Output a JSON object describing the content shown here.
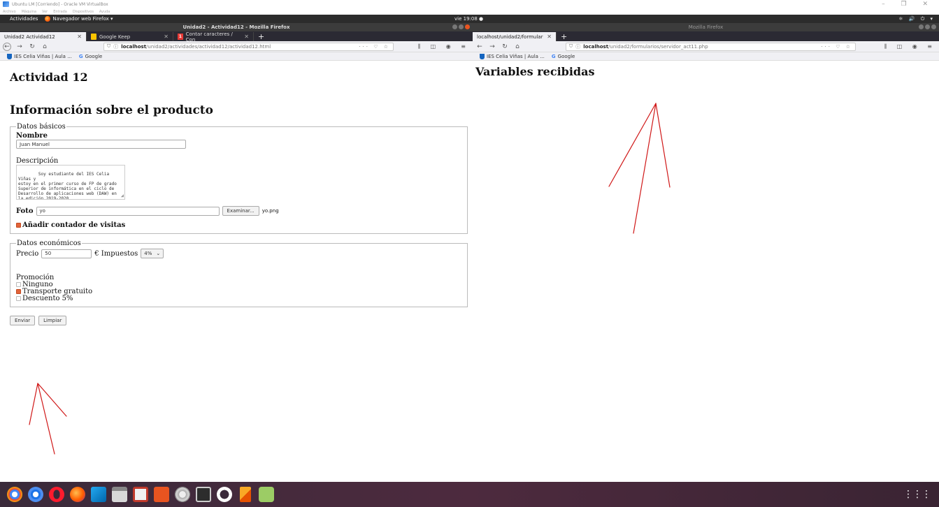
{
  "vbox": {
    "title": "Ubuntu LM [Corriendo] - Oracle VM VirtualBox",
    "menu": [
      "Archivo",
      "Máquina",
      "Ver",
      "Entrada",
      "Dispositivos",
      "Ayuda"
    ],
    "window_controls": "–  ❐  ✕"
  },
  "topbar": {
    "activities": "Actividades",
    "app": "Navegador web Firefox ▾",
    "clock": "vie 19:08 ●",
    "sys": "⚛ 🔊 ⏻ ▾"
  },
  "left": {
    "title": "Unidad2 - Actividad12 - Mozilla Firefox",
    "tabs": [
      {
        "label": "Unidad2 Actividad12",
        "close": "✕"
      },
      {
        "label": "Google Keep",
        "close": "✕"
      },
      {
        "label": "Contar caracteres / Con",
        "close": "✕",
        "badge": "1"
      }
    ],
    "newtab": "+",
    "url_host": "localhost",
    "url_path": "/unidad2/actividades/actividad12/actividad12.html",
    "url_actions": "··· ♡ ☆",
    "tool_icons": "⫼ ◫ ◉ ≡",
    "bookmarks": [
      "IES Celia Viñas | Aula ...",
      "Google"
    ]
  },
  "right": {
    "title": "Mozilla Firefox",
    "tab": {
      "label": "localhost/unidad2/formular",
      "close": "✕"
    },
    "newtab": "+",
    "url_host": "localhost",
    "url_path": "/unidad2/formularios/servidor_act11.php",
    "url_actions": "··· ♡ ☆",
    "tool_icons": "⫼ ◫ ◉ ≡",
    "bookmarks": [
      "IES Celia Viñas | Aula ...",
      "Google"
    ],
    "heading": "Variables recibidas"
  },
  "form": {
    "heading1": "Actividad 12",
    "heading2": "Información sobre el producto",
    "basic": {
      "legend": "Datos básicos",
      "name_label": "Nombre",
      "name_value": "Juan Manuel",
      "desc_label": "Descripción",
      "desc_value": "Soy estudiante del IES Celia Viñas y\nestoy en el primer curso de FP de grado\nSuperior de informática en el ciclo de\nDesarrollo de aplicaciones web (DAW) en\nla edición 2019-2020",
      "photo_label": "Foto",
      "photo_value": "yo",
      "browse_label": "Examinar...",
      "photo_file": "yo.png",
      "counter_label": "Añadir contador de visitas"
    },
    "economic": {
      "legend": "Datos económicos",
      "price_label": "Precio",
      "price_value": "50",
      "tax_label": "€ Impuestos",
      "tax_value": "4%",
      "tax_chevron": "⌄",
      "promo_label": "Promoción",
      "promos": [
        "Ninguno",
        "Transporte gratuito",
        "Descuento 5%"
      ]
    },
    "submit_label": "Enviar",
    "reset_label": "Limpiar"
  },
  "dock": {
    "apps_icon": "⋮⋮⋮"
  },
  "colors": {
    "ubuntu_orange": "#e95420",
    "annotation_red": "#d01818",
    "dock": "#4d2a3e"
  }
}
